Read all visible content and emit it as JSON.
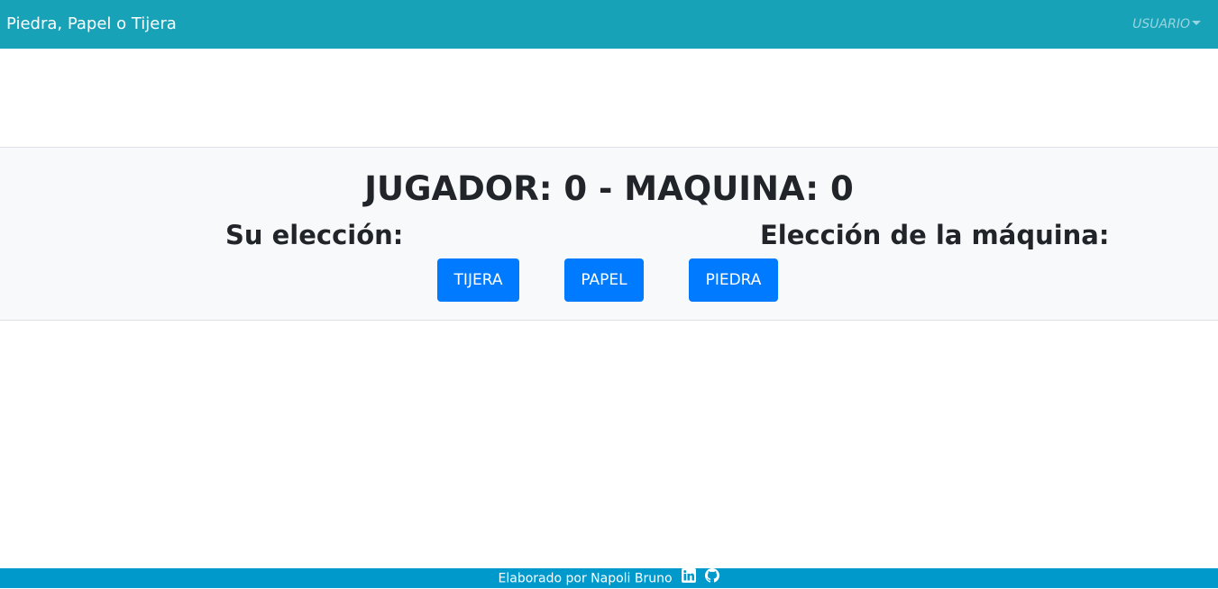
{
  "navbar": {
    "brand": "Piedra, Papel o Tijera",
    "user_menu": "USUARIO"
  },
  "game": {
    "score": "JUGADOR: 0 - MAQUINA: 0",
    "player_choice_label": "Su elección:",
    "machine_choice_label": "Elección de la máquina:",
    "buttons": {
      "tijera": "TIJERA",
      "papel": "PAPEL",
      "piedra": "PIEDRA"
    }
  },
  "footer": {
    "text": "Elaborado por Napoli Bruno",
    "icons": [
      "linkedin-icon",
      "github-icon"
    ]
  },
  "colors": {
    "navbar": "#17a2b8",
    "panel": "#f8f9fa",
    "button": "#007bff",
    "footer": "#0099cc"
  }
}
